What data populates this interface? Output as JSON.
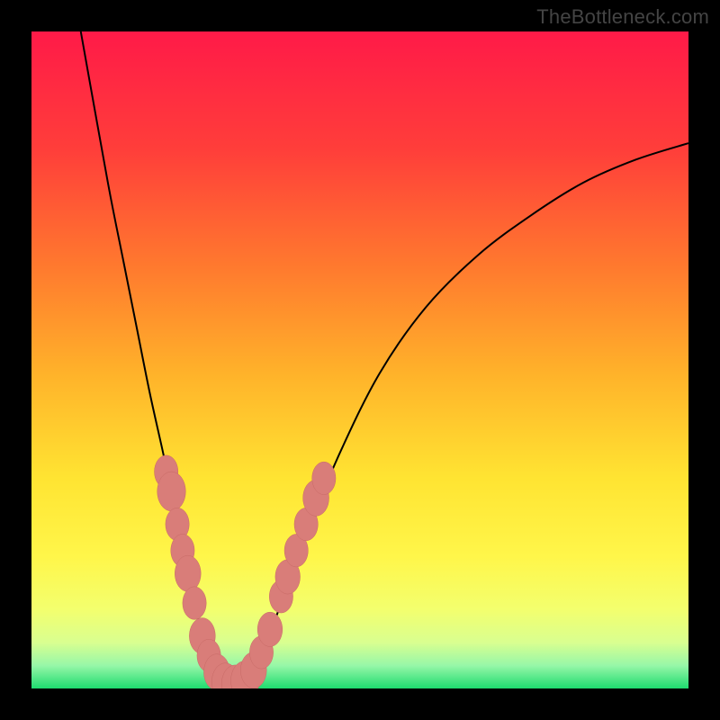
{
  "watermark": "TheBottleneck.com",
  "colors": {
    "frame": "#000000",
    "curve": "#000000",
    "marker_fill": "#d97d79",
    "marker_stroke": "#c86a66",
    "gradient_stops": [
      {
        "offset": 0.0,
        "color": "#ff1a48"
      },
      {
        "offset": 0.18,
        "color": "#ff3e3a"
      },
      {
        "offset": 0.36,
        "color": "#ff7a2e"
      },
      {
        "offset": 0.52,
        "color": "#ffb22a"
      },
      {
        "offset": 0.68,
        "color": "#ffe432"
      },
      {
        "offset": 0.8,
        "color": "#fff64a"
      },
      {
        "offset": 0.88,
        "color": "#f3ff6e"
      },
      {
        "offset": 0.93,
        "color": "#d9ff90"
      },
      {
        "offset": 0.965,
        "color": "#97f7a8"
      },
      {
        "offset": 1.0,
        "color": "#1edb6f"
      }
    ]
  },
  "chart_data": {
    "type": "line",
    "title": "",
    "xlabel": "",
    "ylabel": "",
    "xlim": [
      0,
      100
    ],
    "ylim": [
      0,
      100
    ],
    "series": [
      {
        "name": "left-arm",
        "x": [
          7.5,
          10,
          12,
          14,
          16,
          18,
          20,
          21.5,
          23,
          24.5,
          25.5,
          26.5,
          27.5,
          28.5
        ],
        "y": [
          100,
          86,
          75,
          65,
          55,
          45,
          36,
          29,
          22,
          15,
          10,
          6,
          3,
          1.2
        ]
      },
      {
        "name": "valley-floor",
        "x": [
          28.5,
          30,
          31.5,
          33
        ],
        "y": [
          1.2,
          0.6,
          0.6,
          1.2
        ]
      },
      {
        "name": "right-arm",
        "x": [
          33,
          35,
          38,
          42,
          47,
          53,
          60,
          68,
          76,
          84,
          92,
          100
        ],
        "y": [
          1.2,
          5,
          13,
          24,
          36,
          48,
          58,
          66,
          72,
          77,
          80.5,
          83
        ]
      }
    ],
    "markers": {
      "name": "highlight-dots",
      "points": [
        {
          "x": 20.5,
          "y": 33,
          "r": 2.0
        },
        {
          "x": 21.3,
          "y": 30,
          "r": 2.4
        },
        {
          "x": 22.2,
          "y": 25,
          "r": 2.0
        },
        {
          "x": 23.0,
          "y": 21,
          "r": 2.0
        },
        {
          "x": 23.8,
          "y": 17.5,
          "r": 2.2
        },
        {
          "x": 24.8,
          "y": 13,
          "r": 2.0
        },
        {
          "x": 26.0,
          "y": 8,
          "r": 2.2
        },
        {
          "x": 27.0,
          "y": 5,
          "r": 2.0
        },
        {
          "x": 28.2,
          "y": 2.5,
          "r": 2.2
        },
        {
          "x": 29.5,
          "y": 1.0,
          "r": 2.3
        },
        {
          "x": 31.0,
          "y": 0.7,
          "r": 2.3
        },
        {
          "x": 32.5,
          "y": 1.2,
          "r": 2.4
        },
        {
          "x": 33.8,
          "y": 2.8,
          "r": 2.2
        },
        {
          "x": 35.0,
          "y": 5.5,
          "r": 2.0
        },
        {
          "x": 36.3,
          "y": 9.0,
          "r": 2.1
        },
        {
          "x": 38.0,
          "y": 14,
          "r": 2.0
        },
        {
          "x": 39.0,
          "y": 17,
          "r": 2.1
        },
        {
          "x": 40.3,
          "y": 21,
          "r": 2.0
        },
        {
          "x": 41.8,
          "y": 25,
          "r": 2.0
        },
        {
          "x": 43.3,
          "y": 29,
          "r": 2.2
        },
        {
          "x": 44.5,
          "y": 32,
          "r": 2.0
        }
      ]
    }
  }
}
